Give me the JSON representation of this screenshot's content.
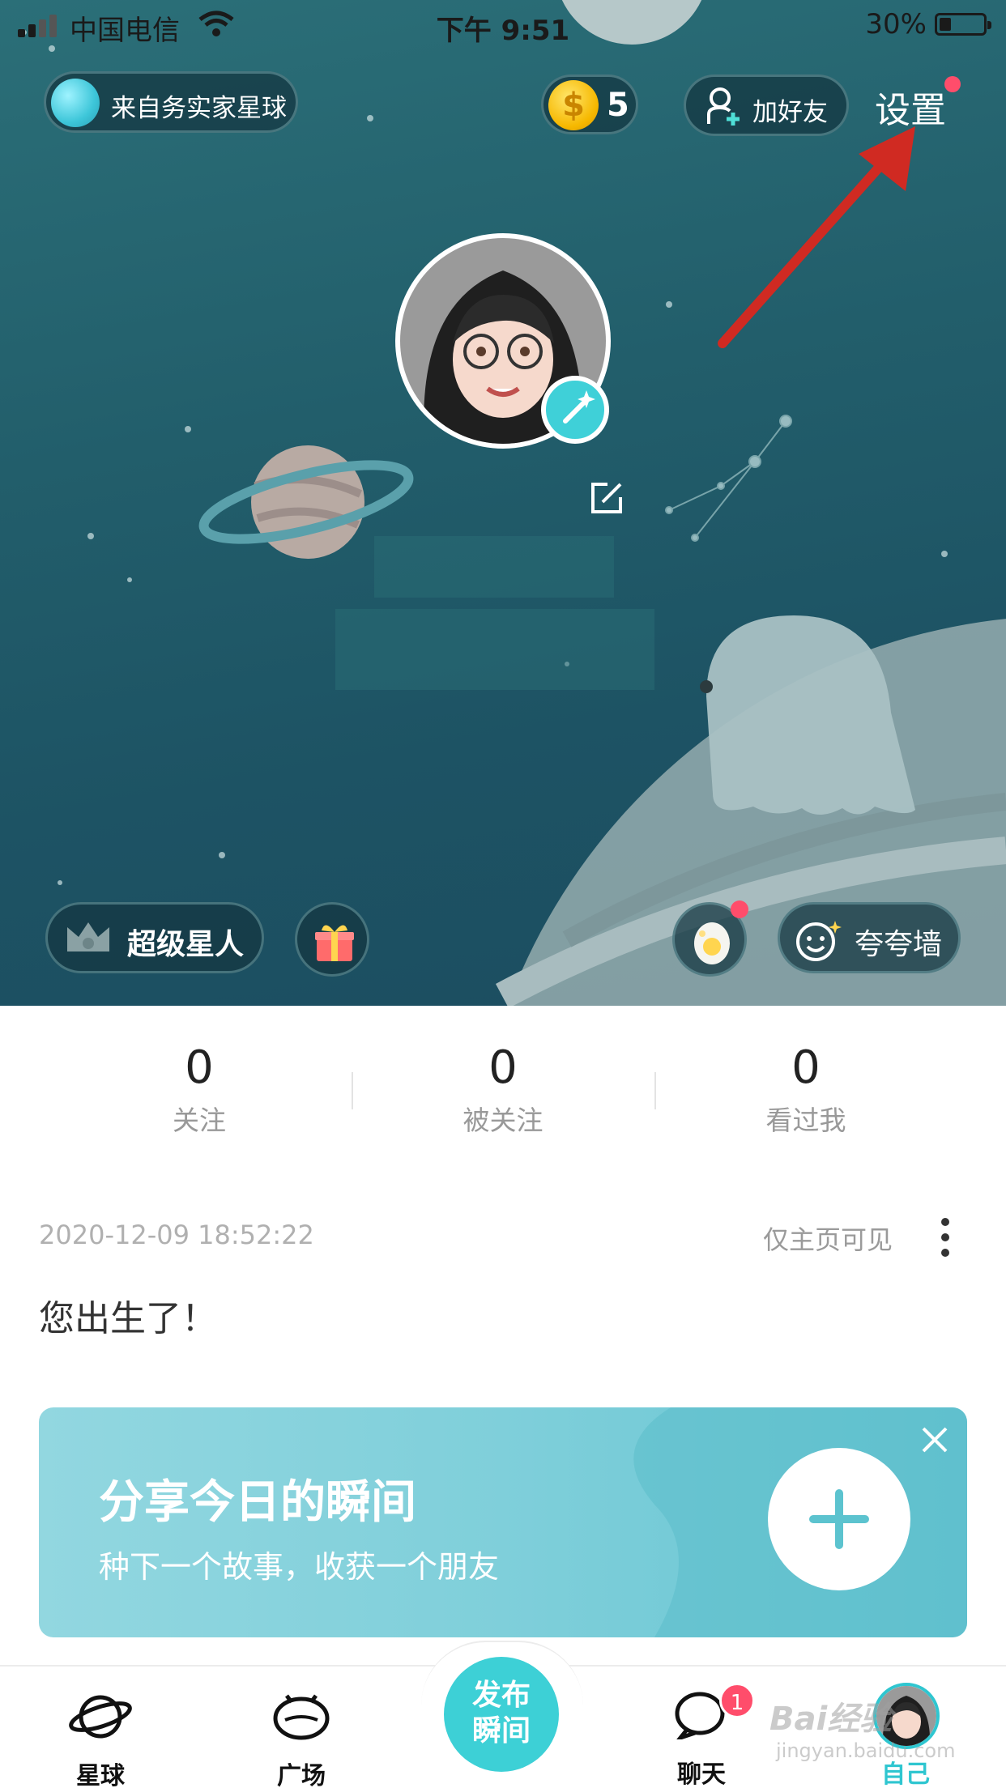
{
  "status_bar": {
    "carrier": "中国电信",
    "time": "下午 9:51",
    "battery_percent": "30%",
    "battery_level": 0.3
  },
  "header": {
    "origin_planet": "来自务实家星球",
    "coins": "5",
    "add_friend": "加好友",
    "settings": "设置"
  },
  "hero_actions": {
    "vip": "超级星人",
    "praise_wall": "夸夸墙"
  },
  "stats": [
    {
      "value": "0",
      "label": "关注"
    },
    {
      "value": "0",
      "label": "被关注"
    },
    {
      "value": "0",
      "label": "看过我"
    }
  ],
  "post": {
    "date": "2020-12-09 18:52:22",
    "visibility": "仅主页可见",
    "text": "您出生了！"
  },
  "share_card": {
    "title": "分享今日的瞬间",
    "subtitle": "种下一个故事，收获一个朋友"
  },
  "tabbar": {
    "planet": "星球",
    "plaza": "广场",
    "publish_line1": "发布",
    "publish_line2": "瞬间",
    "chat": "聊天",
    "chat_badge": "1",
    "me": "自己"
  },
  "colors": {
    "accent": "#3dd0d6",
    "badge": "#ff4d6b",
    "hero_bg": "#225e6b"
  }
}
